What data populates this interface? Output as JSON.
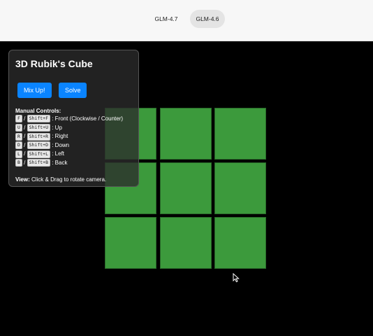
{
  "tabs": [
    {
      "label": "GLM-4.7",
      "active": false
    },
    {
      "label": "GLM-4.6",
      "active": true
    }
  ],
  "panel": {
    "title": "3D Rubik's Cube",
    "buttons": {
      "mix": "Mix Up!",
      "solve": "Solve"
    },
    "controls_heading": "Manual Controls:",
    "controls": [
      {
        "key": "F",
        "shift_key": "Shift+F",
        "desc": ": Front (Clockwise / Counter)"
      },
      {
        "key": "U",
        "shift_key": "Shift+U",
        "desc": ": Up"
      },
      {
        "key": "R",
        "shift_key": "Shift+R",
        "desc": ": Right"
      },
      {
        "key": "D",
        "shift_key": "Shift+D",
        "desc": ": Down"
      },
      {
        "key": "L",
        "shift_key": "Shift+L",
        "desc": ": Left"
      },
      {
        "key": "B",
        "shift_key": "Shift+B",
        "desc": ": Back"
      }
    ],
    "view_label": "View:",
    "view_text": " Click & Drag to rotate camera."
  },
  "cube_face": {
    "color": "#3c9a3c",
    "stickers": [
      "green",
      "green",
      "green",
      "green",
      "green",
      "green",
      "green",
      "green",
      "green"
    ]
  }
}
